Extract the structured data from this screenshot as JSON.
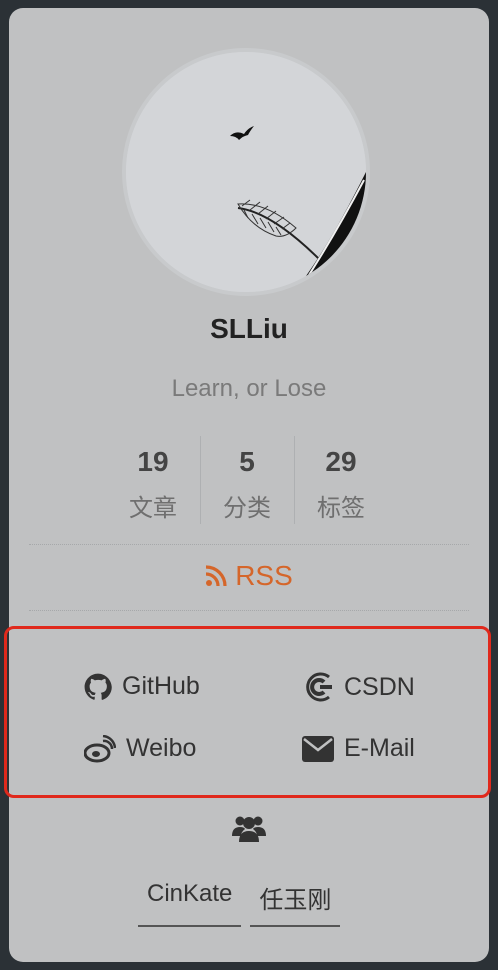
{
  "profile": {
    "name": "SLLiu",
    "motto": "Learn, or Lose"
  },
  "stats": [
    {
      "value": "19",
      "label": "文章"
    },
    {
      "value": "5",
      "label": "分类"
    },
    {
      "value": "29",
      "label": "标签"
    }
  ],
  "rss": {
    "label": "RSS",
    "color": "#d5662a"
  },
  "social_links": [
    {
      "label": "GitHub",
      "icon": "github-icon"
    },
    {
      "label": "CSDN",
      "icon": "csdn-icon"
    },
    {
      "label": "Weibo",
      "icon": "weibo-icon"
    },
    {
      "label": "E-Mail",
      "icon": "envelope-icon"
    }
  ],
  "highlight_color": "#e0291c",
  "friends": {
    "icon": "users-icon",
    "links": [
      "CinKate",
      "任玉刚"
    ]
  }
}
